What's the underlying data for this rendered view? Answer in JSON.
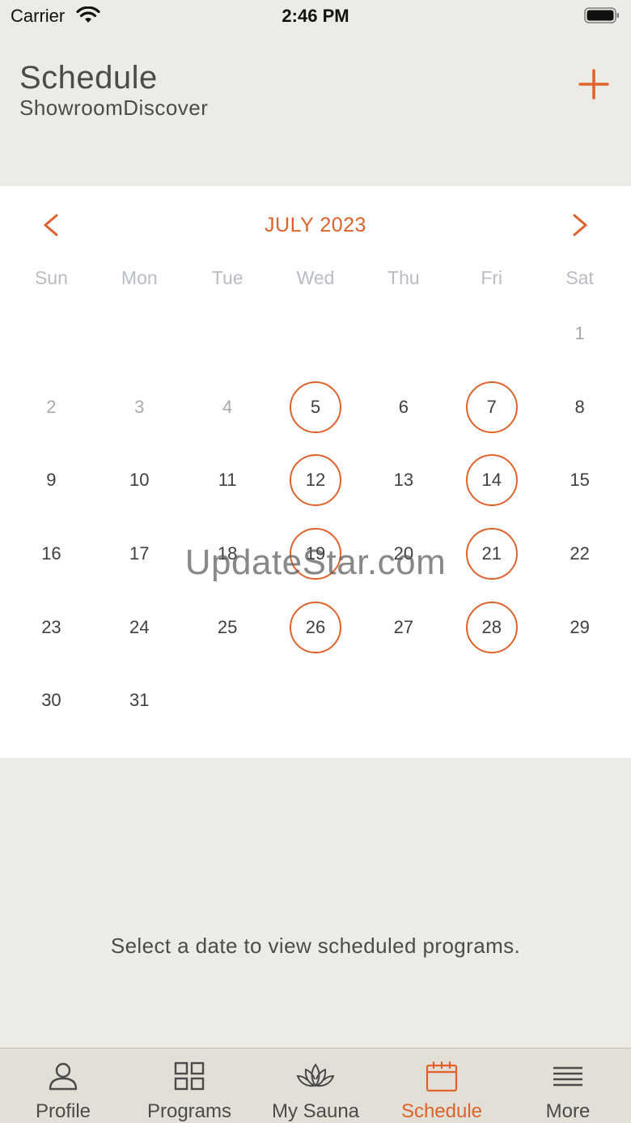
{
  "status_bar": {
    "carrier": "Carrier",
    "time": "2:46 PM"
  },
  "header": {
    "title": "Schedule",
    "subtitle": "ShowroomDiscover"
  },
  "calendar": {
    "month_label": "JULY 2023",
    "weekdays": [
      "Sun",
      "Mon",
      "Tue",
      "Wed",
      "Thu",
      "Fri",
      "Sat"
    ],
    "weeks": [
      [
        null,
        null,
        null,
        null,
        null,
        null,
        "1"
      ],
      [
        "2",
        "3",
        "4",
        "5",
        "6",
        "7",
        "8"
      ],
      [
        "9",
        "10",
        "11",
        "12",
        "13",
        "14",
        "15"
      ],
      [
        "16",
        "17",
        "18",
        "19",
        "20",
        "21",
        "22"
      ],
      [
        "23",
        "24",
        "25",
        "26",
        "27",
        "28",
        "29"
      ],
      [
        "30",
        "31",
        null,
        null,
        null,
        null,
        null
      ]
    ],
    "muted_days": [
      "1",
      "2",
      "3",
      "4"
    ],
    "scheduled_days": [
      "5",
      "7",
      "12",
      "14",
      "19",
      "21",
      "26",
      "28"
    ]
  },
  "watermark": "UpdateStar.com",
  "empty_message": "Select a date to view scheduled programs.",
  "tabs": [
    {
      "label": "Profile",
      "icon": "person-icon",
      "active": false
    },
    {
      "label": "Programs",
      "icon": "grid-icon",
      "active": false
    },
    {
      "label": "My Sauna",
      "icon": "lotus-icon",
      "active": false
    },
    {
      "label": "Schedule",
      "icon": "calendar-icon",
      "active": true
    },
    {
      "label": "More",
      "icon": "menu-icon",
      "active": false
    }
  ],
  "colors": {
    "accent": "#e0622a",
    "background": "#edebe5",
    "tabbar": "#e2dfd6"
  }
}
